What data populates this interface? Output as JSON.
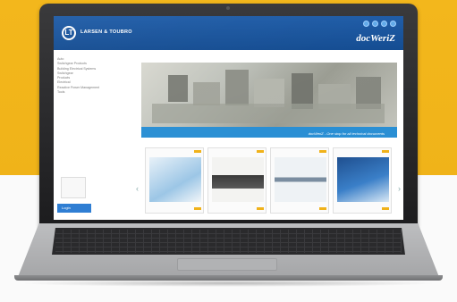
{
  "app": {
    "company_name": "LARSEN & TOUBRO",
    "logo_text": "LT",
    "brand": "docWeriZ",
    "header_icons": [
      "globe-icon",
      "share-icon",
      "user-icon",
      "help-icon"
    ]
  },
  "sidebar": {
    "items": [
      "Auto",
      "Switchgear Products",
      "Building Electrical Systems",
      "Switchgear",
      "Products",
      "Electrical",
      "Reactive Power Management",
      "Tools"
    ],
    "login_label": "Login"
  },
  "banner": {
    "caption": "docWeriZ - One stop for all technical documents"
  },
  "thumbnails": {
    "count": 4
  },
  "colors": {
    "background": "#f3b71c",
    "header": "#1c5aa6",
    "accent": "#2a8fd4",
    "tag": "#f0b21a"
  }
}
